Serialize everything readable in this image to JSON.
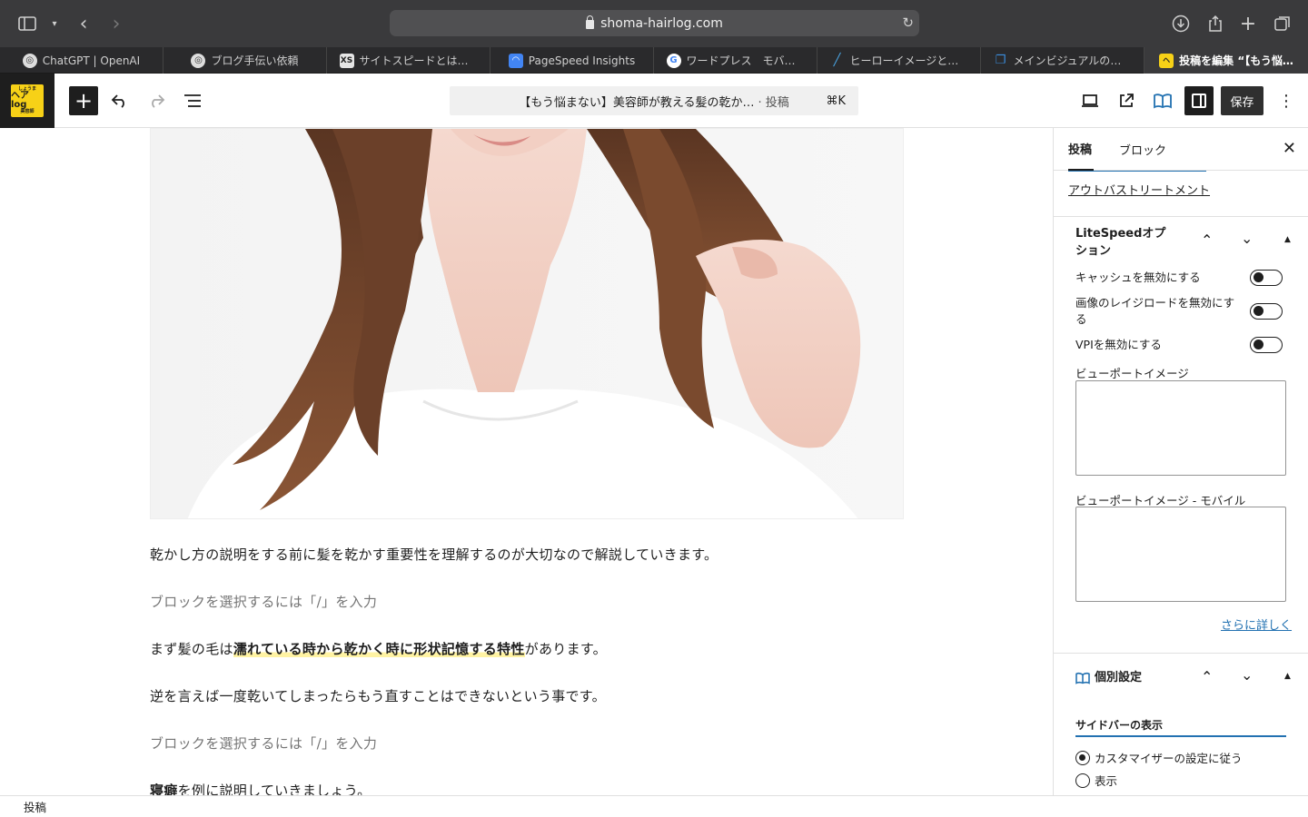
{
  "browser": {
    "url": "shoma-hairlog.com",
    "tabs": [
      {
        "title": "ChatGPT | OpenAI",
        "icon": "openai-icon"
      },
      {
        "title": "ブログ手伝い依頼",
        "icon": "openai-icon"
      },
      {
        "title": "サイトスピードとは？P…",
        "icon": "xs-icon"
      },
      {
        "title": "PageSpeed Insights",
        "icon": "pagespeed-icon"
      },
      {
        "title": "ワードプレス　モバイ…",
        "icon": "google-icon"
      },
      {
        "title": "ヒーローイメージとは…",
        "icon": "brush-icon"
      },
      {
        "title": "メインビジュアルの表…",
        "icon": "book-icon"
      },
      {
        "title": "投稿を編集 “【もう悩…",
        "icon": "site-icon",
        "active": true
      }
    ]
  },
  "editor": {
    "logo": {
      "small": "しょうま",
      "main": "ヘアlog",
      "sub": "美容師"
    },
    "doc_title": "【もう悩まない】美容師が教える髪の乾か…",
    "doc_type": "· 投稿",
    "shortcut": "⌘K",
    "save_label": "保存"
  },
  "content": {
    "p1": "乾かし方の説明をする前に髪を乾かす重要性を理解するのが大切なので解説していきます。",
    "placeholder1": "ブロックを選択するには「/」を入力",
    "p2_before": "まず髪の毛は",
    "p2_highlight": "濡れている時から乾かく時に形状記憶する特性",
    "p2_after": "があります。",
    "p3": "逆を言えば一度乾いてしまったらもう直すことはできないという事です。",
    "placeholder2": "ブロックを選択するには「/」を入力",
    "p4_bold": "寝癖",
    "p4_rest": "を例に説明していきましょう。"
  },
  "sidebar": {
    "tab_post": "投稿",
    "tab_block": "ブロック",
    "outbath_link": "アウトバストリートメント",
    "litespeed": {
      "title": "LiteSpeedオプ",
      "title_line2": "ション",
      "options": [
        {
          "label": "キャッシュを無効にする",
          "enabled": false
        },
        {
          "label": "画像のレイジロードを無効にす",
          "label_line2": "る",
          "enabled": false
        },
        {
          "label": "VPIを無効にする",
          "enabled": false
        }
      ],
      "viewport_image_label": "ビューポートイメージ",
      "viewport_image_mobile_label": "ビューポートイメージ - モバイル",
      "more_link": "さらに詳しく"
    },
    "individual": {
      "title": "個別設定",
      "sidebar_display_title": "サイドバーの表示",
      "radio_options": [
        {
          "label": "カスタマイザーの設定に従う",
          "checked": true
        },
        {
          "label": "表示",
          "checked": false
        }
      ]
    }
  },
  "footer": {
    "label": "投稿"
  }
}
